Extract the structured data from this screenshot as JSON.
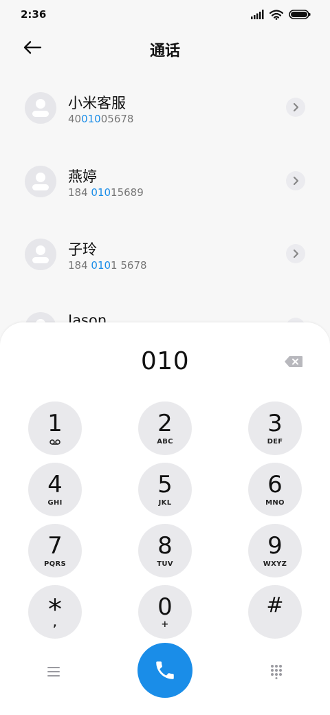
{
  "status": {
    "time": "2:36"
  },
  "header": {
    "title": "通话"
  },
  "contacts": [
    {
      "name": "小米客服",
      "number_pre": "40",
      "number_match": "010",
      "number_post": "05678"
    },
    {
      "name": "燕婷",
      "number_pre": "184 ",
      "number_match": "010",
      "number_post": "15689"
    },
    {
      "name": "子玲",
      "number_pre": "184 ",
      "number_match": "010",
      "number_post": "1 5678"
    },
    {
      "name": "Jason",
      "number_pre": "",
      "number_match": "",
      "number_post": ""
    }
  ],
  "dialer": {
    "number": "010",
    "keys": [
      {
        "digit": "1",
        "letters": ""
      },
      {
        "digit": "2",
        "letters": "ABC"
      },
      {
        "digit": "3",
        "letters": "DEF"
      },
      {
        "digit": "4",
        "letters": "GHI"
      },
      {
        "digit": "5",
        "letters": "JKL"
      },
      {
        "digit": "6",
        "letters": "MNO"
      },
      {
        "digit": "7",
        "letters": "PQRS"
      },
      {
        "digit": "8",
        "letters": "TUV"
      },
      {
        "digit": "9",
        "letters": "WXYZ"
      },
      {
        "digit": "*",
        "letters": ","
      },
      {
        "digit": "0",
        "letters": "+"
      },
      {
        "digit": "#",
        "letters": ""
      }
    ]
  },
  "colors": {
    "accent": "#1a8de8",
    "key_bg": "#e9e9ec",
    "avatar_bg": "#e6e6ea"
  },
  "icons": {
    "back": "arrow-left-icon",
    "detail": "chevron-right-icon",
    "delete": "backspace-icon",
    "voicemail": "voicemail-icon",
    "menu": "menu-icon",
    "call": "phone-icon",
    "keypad": "dialpad-icon"
  }
}
